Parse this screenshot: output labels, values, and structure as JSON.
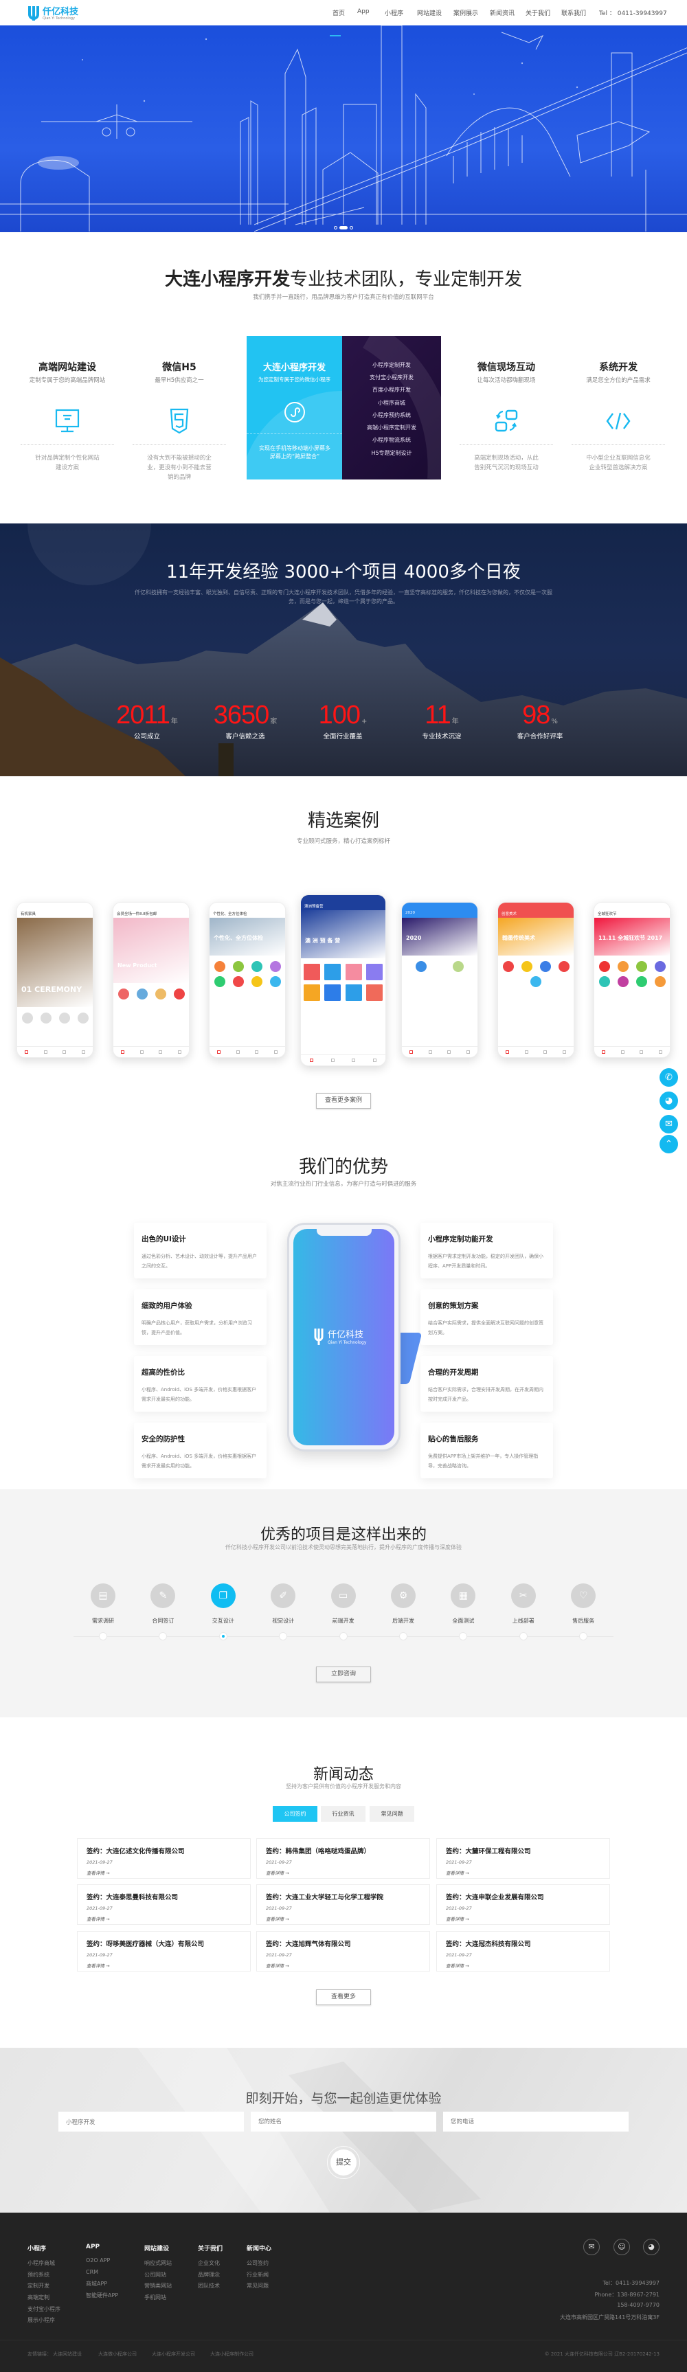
{
  "header": {
    "logo_text": "仟亿科技",
    "logo_sub": "Qian Yi Technology",
    "nav": [
      "首页",
      "App",
      "小程序",
      "网站建设",
      "案例展示",
      "新闻资讯",
      "关于我们",
      "联系我们"
    ],
    "tel": "Tel ： 0411-39943997"
  },
  "hero": {
    "active_slide": 2,
    "slide_count": 3
  },
  "services": {
    "title_bold": "大连小程序开发",
    "title_rest": "专业技术团队，专业定制开发",
    "subtitle": "我们携手并一直践行，用品牌思维为客户打造真正有价值的互联网平台",
    "items": [
      {
        "title": "高端网站建设",
        "subtitle": "定制专属于您的高端品牌网站",
        "icon": "monitor-icon",
        "desc": "针对品牌定制个性化网站建设方案"
      },
      {
        "title": "微信H5",
        "subtitle": "最早H5供应商之一",
        "icon": "html5-icon",
        "desc": "没有大到不能被撼动的企业，更没有小到不能去营销的品牌"
      },
      {
        "title": "大连小程序开发",
        "subtitle": "为您定制专属于您的微信小程序",
        "icon": "mini-program-icon",
        "desc": "实现在手机等移动端小屏幕多屏幕上的“跨屏整合”"
      },
      {
        "title": "微信现场互动",
        "subtitle": "让每次活动都嗨翻现场",
        "icon": "interaction-icon",
        "desc": "高端定制现场活动，从此告别死气沉沉的现场互动"
      },
      {
        "title": "系统开发",
        "subtitle": "满足您全方位的产品需求",
        "icon": "code-icon",
        "desc": "中小型企业互联网信息化企业转型首选解决方案"
      }
    ],
    "featured_list": [
      "小程序定制开发",
      "支付宝小程序开发",
      "百度小程序开发",
      "小程序商城",
      "小程序预约系统",
      "高端小程序定制开发",
      "小程序物流系统",
      "H5专题定制设计"
    ],
    "accent": "#22c3f2"
  },
  "stats": {
    "title": "11年开发经验  3000+个项目  4000多个日夜",
    "paragraph": "仟亿科技拥有一支经验丰富、眼光独到、自信尽责、正规的专门大连小程序开发技术团队，凭借多年的经验，一直坚守高标准的服务，仟亿科技在为您做的，不仅仅是一次服务，而是与您一起，缔造一个属于您的产品。",
    "items": [
      {
        "number": "2011",
        "unit": "年",
        "label": "公司成立"
      },
      {
        "number": "3650",
        "unit": "家",
        "label": "客户信赖之选"
      },
      {
        "number": "100",
        "unit": "+",
        "label": "全面行业覆盖"
      },
      {
        "number": "11",
        "unit": "年",
        "label": "专业技术沉淀"
      },
      {
        "number": "98",
        "unit": "%",
        "label": "客户合作好评率"
      }
    ],
    "number_color": "#ff1515"
  },
  "cases": {
    "title": "精选案例",
    "subtitle": "专业顾问式服务，精心打造案例标杆",
    "more_button": "查看更多案例",
    "phones": [
      {
        "bar": "有机家具",
        "hero": "01 CEREMONY",
        "hero_color": "#8a6a48",
        "bar_color": "#ffffff",
        "icons": [
          "#ddd",
          "#ddd",
          "#ddd",
          "#ddd"
        ]
      },
      {
        "bar": "会员全场一件8.8折包邮",
        "hero": "New Product",
        "hero_color": "#f2b8c8",
        "bar_color": "#ffffff",
        "icons": [
          "#e66",
          "#6ad",
          "#eb6",
          "#e44"
        ]
      },
      {
        "bar": "个性化、全方位体检",
        "hero": "个性化、全方位体检",
        "hero_color": "#9fb5c9",
        "bar_color": "#ffffff",
        "icons": [
          "#f5813a",
          "#8cc63f",
          "#2ec4b6",
          "#b476e0",
          "#2ecc71",
          "#f04848",
          "#f5c518",
          "#3bb7ee"
        ]
      },
      {
        "bar": "澳洲预备营",
        "hero": "澳 洲 预 备 营",
        "hero_color": "#1d3f9b",
        "bar_color": "#1d3f9b",
        "icons": [
          "#f05a5a",
          "#2d9ee8",
          "#f58ca0",
          "#8a7cf0",
          "#f5a623",
          "#2d7de8",
          "#2d9ee8",
          "#f06a5a"
        ]
      },
      {
        "bar": "2020",
        "hero": "2020",
        "hero_color": "#2a1a6a",
        "bar_color": "#2d8cf0",
        "icons": [
          "#3a8ee6",
          "#b9d88a"
        ]
      },
      {
        "bar": "创意美术",
        "hero": "翰墨传统美术",
        "hero_color": "#f5a623",
        "bar_color": "#f05050",
        "icons": [
          "#e44",
          "#f5c518",
          "#3b7ee6",
          "#e44",
          "#3bb7ee"
        ]
      },
      {
        "bar": "全城狂欢节",
        "hero": "11.11 全城狂欢节 2017",
        "hero_color": "#f0163c",
        "bar_color": "#ffffff",
        "icons": [
          "#e33",
          "#f59a3a",
          "#8cc63f",
          "#6a6ae0",
          "#2ec4b6",
          "#c13fa0",
          "#2ecc71",
          "#f59a3a"
        ]
      }
    ]
  },
  "floating": [
    "phone-icon",
    "qq-icon",
    "wechat-icon",
    "arrow-up-icon"
  ],
  "advantages": {
    "title": "我们的优势",
    "subtitle": "对焦主流行业热门行业信息，为客户打造与时俱进的服务",
    "left": [
      {
        "title": "出色的UI设计",
        "desc": "通过色彩分析、艺术设计、动效设计等，提升产品用户之间的交互。"
      },
      {
        "title": "细致的用户体验",
        "desc": "明确产品核心用户，获取用户需求，分析用户浏览习惯，提升产品价值。"
      },
      {
        "title": "超高的性价比",
        "desc": "小程序、Android、iOS 多端开发，价格实惠根据客户需求开发最实用的功能。"
      },
      {
        "title": "安全的防护性",
        "desc": "小程序、Android、iOS 多端开发，价格实惠根据客户需求开发最实用的功能。"
      }
    ],
    "right": [
      {
        "title": "小程序定制功能开发",
        "desc": "根据客户需求定制开发功能，稳定的开发团队，确保小程序、APP开发质量和时间。"
      },
      {
        "title": "创意的策划方案",
        "desc": "结合客户实际需求，提供全面解决互联网问题的创意策划方案。"
      },
      {
        "title": "合理的开发周期",
        "desc": "结合客户实际需求，合理安排开发周期，在开发周期内按时完成开发产品。"
      },
      {
        "title": "贴心的售后服务",
        "desc": "免费提供APP市场上架并维护一年，专人操作管理指导，完善战略咨询。"
      }
    ],
    "phone_brand": "仟亿科技",
    "phone_brand_sub": "Qian Yi Technology"
  },
  "process": {
    "title": "优秀的项目是这样出来的",
    "subtitle": "仟亿科技小程序开发公司以前沿技术使灵动思想完美落地执行，提升小程序的广度传播与深度体验",
    "steps": [
      {
        "label": "需求调研",
        "icon": "document-icon"
      },
      {
        "label": "合同签订",
        "icon": "contract-icon"
      },
      {
        "label": "交互设计",
        "icon": "interaction-design-icon"
      },
      {
        "label": "视觉设计",
        "icon": "pen-icon"
      },
      {
        "label": "前端开发",
        "icon": "monitor-icon"
      },
      {
        "label": "后端开发",
        "icon": "gear-icon"
      },
      {
        "label": "全面测试",
        "icon": "clipboard-icon"
      },
      {
        "label": "上线部署",
        "icon": "tools-icon"
      },
      {
        "label": "售后服务",
        "icon": "heart-icon"
      }
    ],
    "active_step": 2,
    "button": "立即咨询"
  },
  "news": {
    "title": "新闻动态",
    "subtitle": "坚持为客户提供有价值的小程序开发服务和内容",
    "tabs": [
      "公司签约",
      "行业资讯",
      "常见问题"
    ],
    "active_tab": 0,
    "items": [
      {
        "title": "签约：大连亿述文化传播有限公司",
        "date": "2021-09-27",
        "more": "查看详情 →"
      },
      {
        "title": "签约：韩伟集团（咯咯哒鸡蛋品牌）",
        "date": "2021-09-27",
        "more": "查看详情 →"
      },
      {
        "title": "签约：大麓环保工程有限公司",
        "date": "2021-09-27",
        "more": "查看详情 →"
      },
      {
        "title": "签约：大连泰思曼科技有限公司",
        "date": "2021-09-27",
        "more": "查看详情 →"
      },
      {
        "title": "签约：大连工业大学轻工与化学工程学院",
        "date": "2021-09-27",
        "more": "查看详情 →"
      },
      {
        "title": "签约：大连申联企业发展有限公司",
        "date": "2021-09-27",
        "more": "查看详情 →"
      },
      {
        "title": "签约：呀哆美医疗器械（大连）有限公司",
        "date": "2021-09-27",
        "more": "查看详情 →"
      },
      {
        "title": "签约：大连旭辉气体有限公司",
        "date": "2021-09-27",
        "more": "查看详情 →"
      },
      {
        "title": "签约：大连冠杰科技有限公司",
        "date": "2021-09-27",
        "more": "查看详情 →"
      }
    ],
    "more_button": "查看更多"
  },
  "form": {
    "title": "即刻开始，与您一起创造更优体验",
    "service_value": "小程序开发",
    "name_placeholder": "您的姓名",
    "phone_placeholder": "您的电话",
    "submit": "提交"
  },
  "footer": {
    "columns": [
      {
        "title": "小程序",
        "items": [
          "小程序商城",
          "预约系统",
          "定制开发",
          "高端定制",
          "支付宝小程序",
          "展示小程序"
        ]
      },
      {
        "title": "APP",
        "items": [
          "O2O APP",
          "CRM",
          "商城APP",
          "智能硬件APP"
        ]
      },
      {
        "title": "网站建设",
        "items": [
          "响应式网站",
          "公司网站",
          "营销类网站",
          "手机网站"
        ]
      },
      {
        "title": "关于我们",
        "items": [
          "企业文化",
          "品牌理念",
          "团队技术"
        ]
      },
      {
        "title": "新闻中心",
        "items": [
          "公司签约",
          "行业新闻",
          "常见问题"
        ]
      }
    ],
    "social": [
      "wechat-icon",
      "contact-icon",
      "qq-icon"
    ],
    "tel": "Tel：0411-39943997",
    "phone": "Phone：138-8967-2791",
    "phone2": "158-4097-9770",
    "address": "大连市高新园区广贤路141号万科泊寓3F",
    "links_label": "友情链接：",
    "links": [
      "大连网站建设",
      "大连做小程序公司",
      "大连小程序开发公司",
      "大连小程序制作公司"
    ],
    "copyright": "© 2021  大连仟亿科技有限公司   辽B2-20170242-13"
  }
}
